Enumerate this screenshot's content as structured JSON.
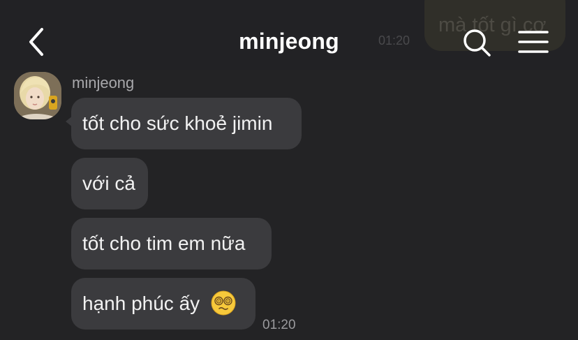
{
  "header": {
    "title": "minjeong"
  },
  "previous": {
    "outgoing_text": "mà tốt gì cơ",
    "time": "01:20"
  },
  "thread": {
    "sender": "minjeong",
    "messages": [
      {
        "text": "tốt cho sức khoẻ jimin"
      },
      {
        "text": "với cả"
      },
      {
        "text": "tốt cho tim em nữa"
      },
      {
        "text": "hạnh phúc ấy",
        "emoji": "dizzy-face-emoji"
      }
    ],
    "time": "01:20"
  },
  "icons": {
    "back": "chevron-left-icon",
    "search": "search-icon",
    "menu": "hamburger-menu-icon"
  },
  "colors": {
    "background": "#232325",
    "bubble": "#3b3b3e",
    "outgoing_bubble": "#4a4630",
    "text": "#f2f2f2",
    "muted": "#a8a8ab"
  }
}
